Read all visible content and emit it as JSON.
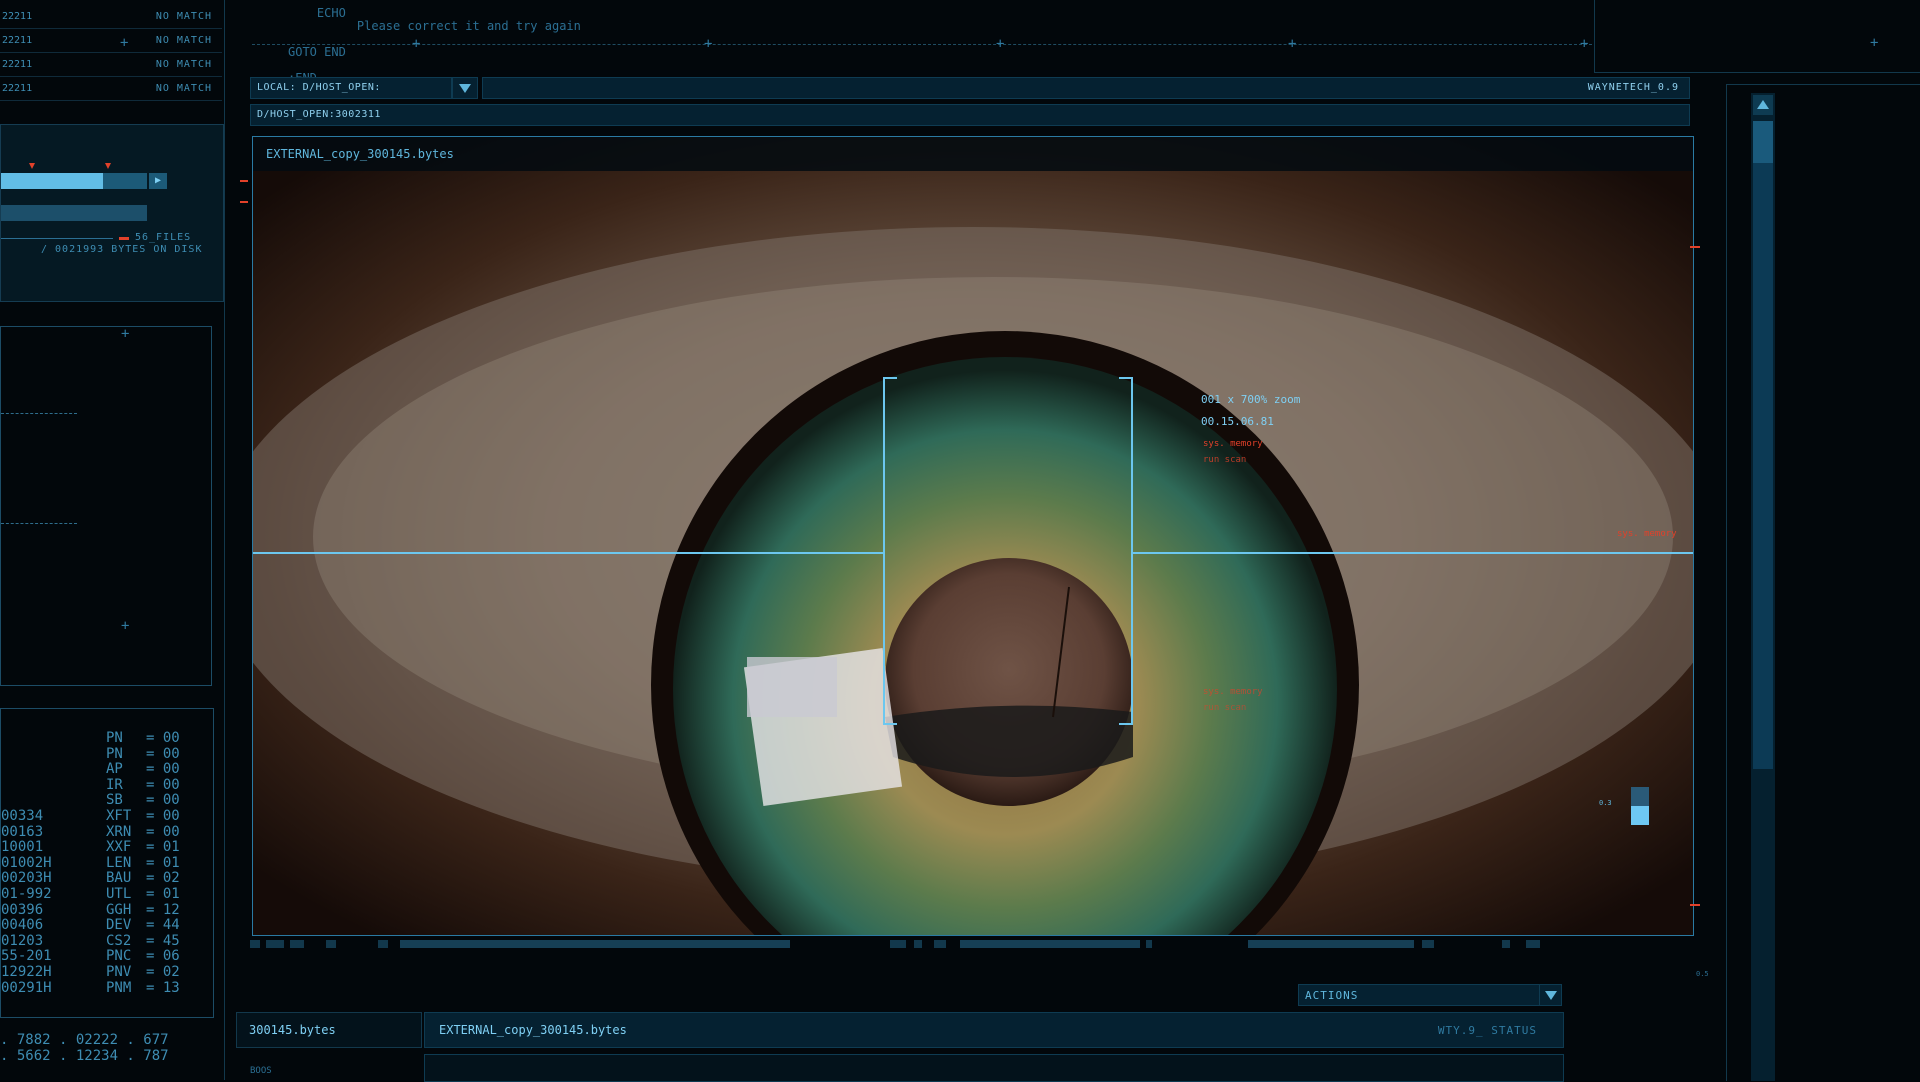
{
  "top_code": {
    "line1a": "ECHO",
    "line1b": "Please correct it and try again",
    "line2": "GOTO END",
    "line3": ":END"
  },
  "left_panel": {
    "match_rows": [
      {
        "code": "22211",
        "status": "NO MATCH"
      },
      {
        "code": "22211",
        "status": "NO MATCH"
      },
      {
        "code": "22211",
        "status": "NO MATCH"
      },
      {
        "code": "22211",
        "status": "NO MATCH"
      }
    ],
    "files_count": "56_FILES",
    "bytes_on_disk": "/ 0021993 BYTES ON DISK",
    "progress": 0.7,
    "register_rows": [
      {
        "c1": "",
        "c2": "PN",
        "c3": "= 00"
      },
      {
        "c1": "",
        "c2": "PN",
        "c3": "= 00"
      },
      {
        "c1": "",
        "c2": "AP",
        "c3": "= 00"
      },
      {
        "c1": "",
        "c2": "IR",
        "c3": "= 00"
      },
      {
        "c1": "",
        "c2": "SB",
        "c3": "= 00"
      },
      {
        "c1": "00334",
        "c2": "XFT",
        "c3": "= 00"
      },
      {
        "c1": "00163",
        "c2": "XRN",
        "c3": "= 00"
      },
      {
        "c1": "10001",
        "c2": "XXF",
        "c3": "= 01"
      },
      {
        "c1": "01002H",
        "c2": "LEN",
        "c3": "= 01"
      },
      {
        "c1": "00203H",
        "c2": "BAU",
        "c3": "= 02"
      },
      {
        "c1": "01-992",
        "c2": "UTL",
        "c3": "= 01"
      },
      {
        "c1": "00396",
        "c2": "GGH",
        "c3": "= 12"
      },
      {
        "c1": "00406",
        "c2": "DEV",
        "c3": "= 44"
      },
      {
        "c1": "01203",
        "c2": "CS2",
        "c3": "= 45"
      },
      {
        "c1": "55-201",
        "c2": "PNC",
        "c3": "= 06"
      },
      {
        "c1": "12922H",
        "c2": "PNV",
        "c3": "= 02"
      },
      {
        "c1": "00291H",
        "c2": "PNM",
        "c3": "= 13"
      }
    ],
    "bottom_rows": [
      ". 7882 . 02222 . 677",
      ". 5662 . 12234 . 787"
    ]
  },
  "toolbar": {
    "local_path": "LOCAL: D/HOST_OPEN:",
    "brand": "WAYNETECH_0.9",
    "host_path": "D/HOST_OPEN:3002311"
  },
  "viewport": {
    "file_title": "EXTERNAL_copy_300145.bytes",
    "zoom": "001 x 700% zoom",
    "timestamp": "00.15.06.81",
    "sys_memory_1": "sys. memory",
    "run_scan_1": "run scan",
    "sys_memory_2": "sys. memory",
    "run_scan_2": "run scan",
    "sys_memory_right": "sys. memory",
    "level_label": "0.3",
    "level_value": 0.5
  },
  "bottom": {
    "file_tab": "300145.bytes",
    "sub_label": "BOOS",
    "main_file": "EXTERNAL_copy_300145.bytes",
    "actions_label": "ACTIONS",
    "status_label": "WTY.9_ STATUS",
    "tiny_label": "0.5"
  },
  "colors": {
    "accent": "#5fb6dc",
    "alert": "#e2412a",
    "background": "#02070b"
  }
}
